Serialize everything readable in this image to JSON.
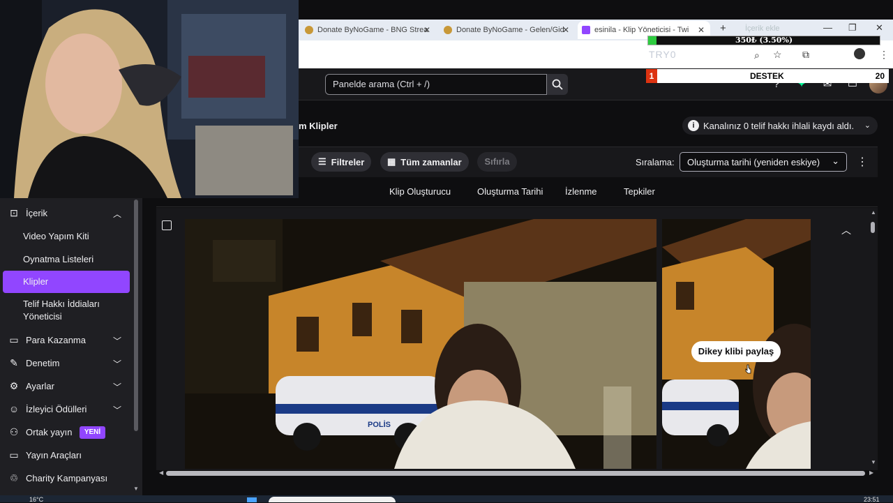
{
  "browser": {
    "tabs": [
      {
        "title": "Donate ByNoGame - BNG Strea",
        "active": false
      },
      {
        "title": "Donate ByNoGame - Gelen/Gid",
        "active": false
      },
      {
        "title": "esinila - Klip Yöneticisi - Twi",
        "active": true
      }
    ],
    "new_tab": "+",
    "window_controls": {
      "minimize": "—",
      "maximize": "❐",
      "close": "✕"
    }
  },
  "overlay": {
    "progress_text": "350₺ (3.50%)",
    "progress_fraction": 0.035,
    "faint_left": "TRY0",
    "faint_top": "İçerik ekle",
    "destek": {
      "rank": "1",
      "label": "DESTEK",
      "count": "20"
    }
  },
  "header": {
    "search_placeholder": "Panelde arama (Ctrl + /)"
  },
  "page": {
    "title": "m Klipler",
    "notice": "Kanalınız 0 telif hakkı ihlali kaydı aldı."
  },
  "filters": {
    "filters_label": "Filtreler",
    "time_label": "Tüm zamanlar",
    "reset_label": "Sıfırla",
    "sort_label": "Sıralama:",
    "sort_value": "Oluşturma tarihi (yeniden eskiye)"
  },
  "columns": [
    "Klip Oluşturucu",
    "Oluşturma Tarihi",
    "İzlenme",
    "Tepkiler"
  ],
  "clip": {
    "tooltip": "Dikey klibi paylaş",
    "police_label": "POLİS"
  },
  "sidebar": {
    "sections": [
      {
        "label": "İçerik",
        "icon": "content-icon",
        "expanded": true
      },
      {
        "label": "Para Kazanma",
        "icon": "money-icon"
      },
      {
        "label": "Denetim",
        "icon": "moderation-icon"
      },
      {
        "label": "Ayarlar",
        "icon": "gear-icon"
      },
      {
        "label": "İzleyici Ödülleri",
        "icon": "rewards-icon"
      },
      {
        "label": "Ortak yayın",
        "icon": "collab-icon",
        "badge": "YENİ"
      },
      {
        "label": "Yayın Araçları",
        "icon": "stream-tools-icon"
      },
      {
        "label": "Charity Kampanyası",
        "icon": "charity-icon"
      }
    ],
    "sub_items": [
      "Video Yapım Kiti",
      "Oynatma Listeleri",
      "Klipler",
      "Telif Hakkı İddiaları Yöneticisi"
    ],
    "active_sub": "Klipler"
  },
  "taskbar": {
    "weather": "16°C",
    "clock": "23:51"
  },
  "colors": {
    "accent": "#9146ff",
    "background": "#0e0e10",
    "surface": "#18181b"
  }
}
